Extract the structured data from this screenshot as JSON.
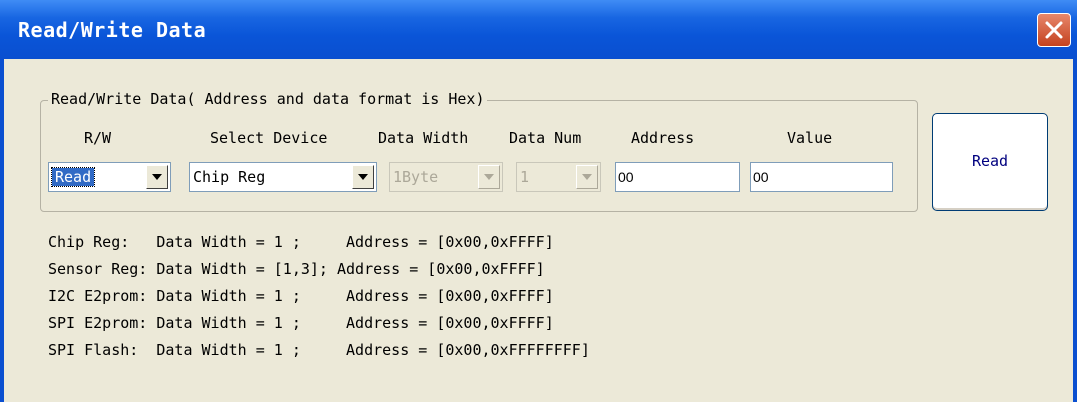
{
  "window": {
    "title": "Read/Write Data"
  },
  "group": {
    "label": "Read/Write Data( Address and data format is Hex)"
  },
  "columns": {
    "rw": "R/W",
    "select_device": "Select Device",
    "data_width": "Data Width",
    "data_num": "Data Num",
    "address": "Address",
    "value": "Value"
  },
  "fields": {
    "rw": "Read",
    "device": "Chip Reg",
    "data_width": "1Byte",
    "data_num": "1",
    "address": "00",
    "value": "00"
  },
  "read_button": "Read",
  "info": [
    "Chip Reg:   Data Width = 1 ;     Address = [0x00,0xFFFF]",
    "Sensor Reg: Data Width = [1,3]; Address = [0x00,0xFFFF]",
    "I2C E2prom: Data Width = 1 ;     Address = [0x00,0xFFFF]",
    "SPI E2prom: Data Width = 1 ;     Address = [0x00,0xFFFF]",
    "SPI Flash:  Data Width = 1 ;     Address = [0x00,0xFFFFFFFF]"
  ],
  "colors": {
    "titlebar": "#0a55d8",
    "close": "#d9532c",
    "face": "#ece9d8",
    "selection": "#316ac5"
  }
}
